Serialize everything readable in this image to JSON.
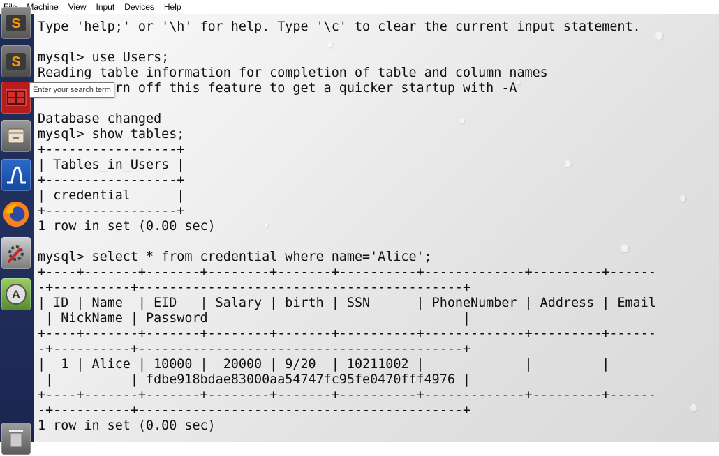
{
  "menubar": {
    "items": [
      "File",
      "Machine",
      "View",
      "Input",
      "Devices",
      "Help"
    ]
  },
  "launcher": {
    "apps": [
      {
        "icon": "sublime-text-icon"
      },
      {
        "icon": "terminal-icon"
      },
      {
        "icon": "file-manager-icon"
      },
      {
        "icon": "wireshark-icon"
      },
      {
        "icon": "firefox-icon"
      },
      {
        "icon": "system-settings-icon"
      },
      {
        "icon": "software-updater-icon"
      },
      {
        "icon": "trash-icon"
      }
    ]
  },
  "tooltip": "Enter your search term",
  "terminal": {
    "lines": [
      "Type 'help;' or '\\h' for help. Type '\\c' to clear the current input statement.",
      "",
      "mysql> use Users;",
      "Reading table information for completion of table and column names",
      "You can turn off this feature to get a quicker startup with -A",
      "",
      "Database changed",
      "mysql> show tables;",
      "+-----------------+",
      "| Tables_in_Users |",
      "+-----------------+",
      "| credential      |",
      "+-----------------+",
      "1 row in set (0.00 sec)",
      "",
      "mysql> select * from credential where name='Alice';",
      "+----+-------+-------+--------+-------+----------+-------------+---------+------",
      "-+----------+------------------------------------------+",
      "| ID | Name  | EID   | Salary | birth | SSN      | PhoneNumber | Address | Email",
      " | NickName | Password                                 |",
      "+----+-------+-------+--------+-------+----------+-------------+---------+------",
      "-+----------+------------------------------------------+",
      "|  1 | Alice | 10000 |  20000 | 9/20  | 10211002 |             |         |",
      " |          | fdbe918bdae83000aa54747fc95fe0470fff4976 |",
      "+----+-------+-------+--------+-------+----------+-------------+---------+------",
      "-+----------+------------------------------------------+",
      "1 row in set (0.00 sec)"
    ]
  }
}
